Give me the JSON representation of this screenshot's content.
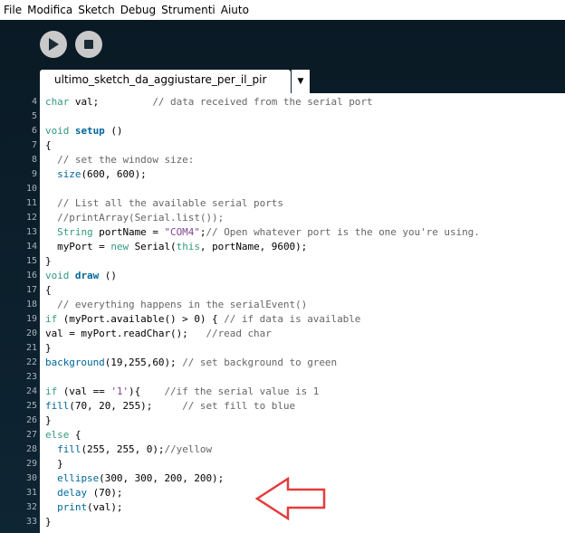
{
  "menu": [
    "File",
    "Modifica",
    "Sketch",
    "Debug",
    "Strumenti",
    "Aiuto"
  ],
  "toolbar": {
    "run_icon": "play-icon",
    "stop_icon": "stop-icon"
  },
  "tab": {
    "label": "ultimo_sketch_da_aggiustare_per_il_pir",
    "menu_icon": "▼"
  },
  "code": {
    "lines": [
      {
        "n": "4"
      },
      {
        "n": "5"
      },
      {
        "n": "6"
      },
      {
        "n": "7"
      },
      {
        "n": "8"
      },
      {
        "n": "9"
      },
      {
        "n": "10"
      },
      {
        "n": "11"
      },
      {
        "n": "12"
      },
      {
        "n": "13"
      },
      {
        "n": "14"
      },
      {
        "n": "15"
      },
      {
        "n": "16"
      },
      {
        "n": "17"
      },
      {
        "n": "18"
      },
      {
        "n": "19"
      },
      {
        "n": "20"
      },
      {
        "n": "21"
      },
      {
        "n": "22"
      },
      {
        "n": "23"
      },
      {
        "n": "24"
      },
      {
        "n": "25"
      },
      {
        "n": "26"
      },
      {
        "n": "27"
      },
      {
        "n": "28"
      },
      {
        "n": "29"
      },
      {
        "n": "30"
      },
      {
        "n": "31"
      },
      {
        "n": "32"
      },
      {
        "n": "33"
      }
    ],
    "tokens": [
      [
        {
          "t": "char",
          "c": "kw"
        },
        {
          "t": " val;         "
        },
        {
          "t": "// data received from the serial port",
          "c": "cm"
        }
      ],
      [],
      [
        {
          "t": "void",
          "c": "kw"
        },
        {
          "t": " "
        },
        {
          "t": "setup",
          "c": "fnb"
        },
        {
          "t": " ()"
        }
      ],
      [
        {
          "t": "{"
        }
      ],
      [
        {
          "t": "  "
        },
        {
          "t": "// set the window size:",
          "c": "cm"
        }
      ],
      [
        {
          "t": "  "
        },
        {
          "t": "size",
          "c": "fn"
        },
        {
          "t": "(600, 600);"
        }
      ],
      [],
      [
        {
          "t": "  "
        },
        {
          "t": "// List all the available serial ports",
          "c": "cm"
        }
      ],
      [
        {
          "t": "  "
        },
        {
          "t": "//printArray(Serial.list());",
          "c": "cm"
        }
      ],
      [
        {
          "t": "  "
        },
        {
          "t": "String",
          "c": "kw"
        },
        {
          "t": " portName = "
        },
        {
          "t": "\"COM4\"",
          "c": "str"
        },
        {
          "t": ";"
        },
        {
          "t": "// Open whatever port is the one you're using.",
          "c": "cm"
        }
      ],
      [
        {
          "t": "  myPort = "
        },
        {
          "t": "new",
          "c": "kw"
        },
        {
          "t": " Serial("
        },
        {
          "t": "this",
          "c": "kw"
        },
        {
          "t": ", portName, 9600);"
        }
      ],
      [
        {
          "t": "}"
        }
      ],
      [
        {
          "t": "void",
          "c": "kw"
        },
        {
          "t": " "
        },
        {
          "t": "draw",
          "c": "fnb"
        },
        {
          "t": " ()"
        }
      ],
      [
        {
          "t": "{"
        }
      ],
      [
        {
          "t": "  "
        },
        {
          "t": "// everything happens in the serialEvent()",
          "c": "cm"
        }
      ],
      [
        {
          "t": "if",
          "c": "kw"
        },
        {
          "t": " (myPort.available() > 0) { "
        },
        {
          "t": "// if data is available",
          "c": "cm"
        }
      ],
      [
        {
          "t": "val = myPort.readChar();   "
        },
        {
          "t": "//read char",
          "c": "cm"
        }
      ],
      [
        {
          "t": "}"
        }
      ],
      [
        {
          "t": "background",
          "c": "fn"
        },
        {
          "t": "(19,255,60); "
        },
        {
          "t": "// set background to green",
          "c": "cm"
        }
      ],
      [],
      [
        {
          "t": "if",
          "c": "kw"
        },
        {
          "t": " (val == "
        },
        {
          "t": "'1'",
          "c": "str"
        },
        {
          "t": "){    "
        },
        {
          "t": "//if the serial value is 1",
          "c": "cm"
        }
      ],
      [
        {
          "t": "fill",
          "c": "fn"
        },
        {
          "t": "(70, 20, 255);     "
        },
        {
          "t": "// set fill to blue",
          "c": "cm"
        }
      ],
      [
        {
          "t": "}"
        }
      ],
      [
        {
          "t": "else",
          "c": "kw"
        },
        {
          "t": " {"
        }
      ],
      [
        {
          "t": "  "
        },
        {
          "t": "fill",
          "c": "fn"
        },
        {
          "t": "(255, 255, 0);"
        },
        {
          "t": "//yellow",
          "c": "cm"
        }
      ],
      [
        {
          "t": "  }"
        }
      ],
      [
        {
          "t": "  "
        },
        {
          "t": "ellipse",
          "c": "fn"
        },
        {
          "t": "(300, 300, 200, 200);"
        }
      ],
      [
        {
          "t": "  "
        },
        {
          "t": "delay",
          "c": "fn"
        },
        {
          "t": " (70);"
        }
      ],
      [
        {
          "t": "  "
        },
        {
          "t": "print",
          "c": "fn"
        },
        {
          "t": "(val);"
        }
      ],
      [
        {
          "t": "}"
        }
      ]
    ]
  },
  "annotation": {
    "icon": "left-arrow-icon",
    "color": "#e53c3c"
  }
}
